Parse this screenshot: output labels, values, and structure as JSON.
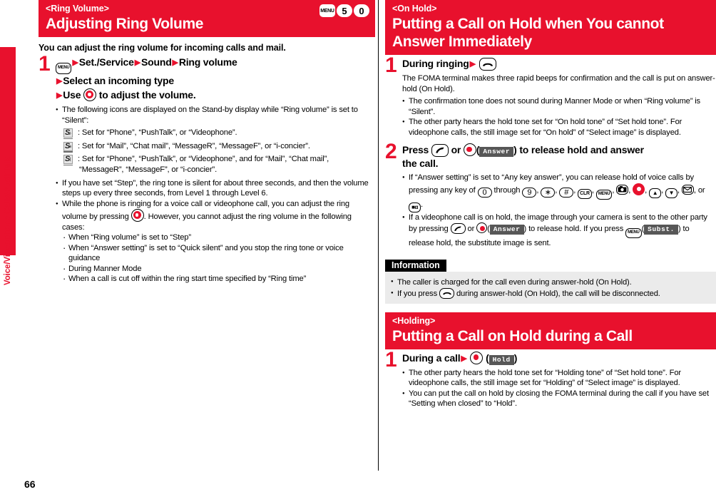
{
  "page_number": "66",
  "side_tab": {
    "label": "Voice/Videophone Calls/PushTalk"
  },
  "left_column": {
    "banner": {
      "sub": "<Ring Volume>",
      "title": "Adjusting Ring Volume",
      "keys": [
        "MENU",
        "5",
        "0"
      ]
    },
    "lead": "You can adjust the ring volume for incoming calls and mail.",
    "step": {
      "number": "1",
      "line1_a": "Set./Service",
      "line1_b": "Sound",
      "line1_c": "Ring volume",
      "line2": "Select an incoming type",
      "line3_a": "Use",
      "line3_b": "to adjust the volume."
    },
    "bullets": {
      "b1": "The following icons are displayed on the Stand-by display while “Ring volume” is set to “Silent”:",
      "icon_rows": [
        {
          "glyph": "S",
          "mark": "♪",
          "text": ": Set for “Phone”, “PushTalk”, or “Videophone”."
        },
        {
          "glyph": "S",
          "mark": "≡",
          "text": ": Set for “Mail”, “Chat mail”, “MessageR”, “MessageF”, or “i-concier”."
        },
        {
          "glyph": "S",
          "mark": "⌇",
          "text": ": Set for “Phone”, “PushTalk”, or “Videophone”, and for “Mail”, “Chat mail”,",
          "text2": "“MessageR”, “MessageF”, or “i-concier”."
        }
      ],
      "b2": "If you have set “Step”, the ring tone is silent for about three seconds, and then the volume steps up every three seconds, from Level 1 through Level 6.",
      "b3_a": "While the phone is ringing for a voice call or videophone call, you can adjust the ring volume by pressing",
      "b3_b": ". However, you cannot adjust the ring volume in the following cases:",
      "sub_items": [
        "When “Ring volume” is set to “Step”",
        "When “Answer setting” is set to “Quick silent” and you stop the ring tone or voice guidance",
        "During Manner Mode",
        "When a call is cut off within the ring start time specified by “Ring time”"
      ]
    }
  },
  "right_column": {
    "section_on_hold": {
      "banner": {
        "sub": "<On Hold>",
        "title_line1": "Putting a Call on Hold when You cannot",
        "title_line2": "Answer Immediately"
      },
      "step1": {
        "number": "1",
        "head": "During ringing",
        "desc": "The FOMA terminal makes three rapid beeps for confirmation and the call is put on answer-hold (On Hold).",
        "bullets": [
          "The confirmation tone does not sound during Manner Mode or when “Ring volume” is “Silent”.",
          "The other party hears the hold tone set for “On hold tone” of “Set hold tone”. For videophone calls, the still image set for “On hold” of “Select image” is displayed."
        ]
      },
      "step2": {
        "number": "2",
        "head_a": "Press",
        "head_or": "or",
        "softkey": "Answer",
        "head_b": "to release hold and answer",
        "head_c": "the call.",
        "bullet1_a": "If “Answer setting” is set to “Any key answer”, you can release hold of voice calls by pressing any key of",
        "bullet1_through": "through",
        "bullet1_or": ", or",
        "bullet1_end": ".",
        "bullet2_a": "If a videophone call is on hold, the image through your camera is sent to the other party by pressing",
        "bullet2_or": "or",
        "bullet2_b": "to release hold. If you press",
        "bullet2_softkey2": "Subst.",
        "bullet2_c": "to release hold, the substitute image is sent.",
        "keys_row": [
          "0",
          "9",
          "∗",
          "#",
          "CLR",
          "MENU",
          "camera",
          "nav",
          "up",
          "down",
          "mail",
          "i-mode"
        ]
      },
      "information": {
        "heading": "Information",
        "bullets": [
          "The caller is charged for the call even during answer-hold (On Hold).",
          {
            "a": "If you press",
            "b": "during answer-hold (On Hold), the call will be disconnected."
          }
        ]
      }
    },
    "section_holding": {
      "banner": {
        "sub": "<Holding>",
        "title": "Putting a Call on Hold during a Call"
      },
      "step1": {
        "number": "1",
        "head": "During a call",
        "softkey": "Hold",
        "bullets": [
          "The other party hears the hold tone set for “Holding tone” of “Set hold tone”. For videophone calls, the still image set for “Holding” of “Select image” is displayed.",
          "You can put the call on hold by closing the FOMA terminal during the call if you have set “Setting when closed” to “Hold”."
        ]
      }
    }
  }
}
